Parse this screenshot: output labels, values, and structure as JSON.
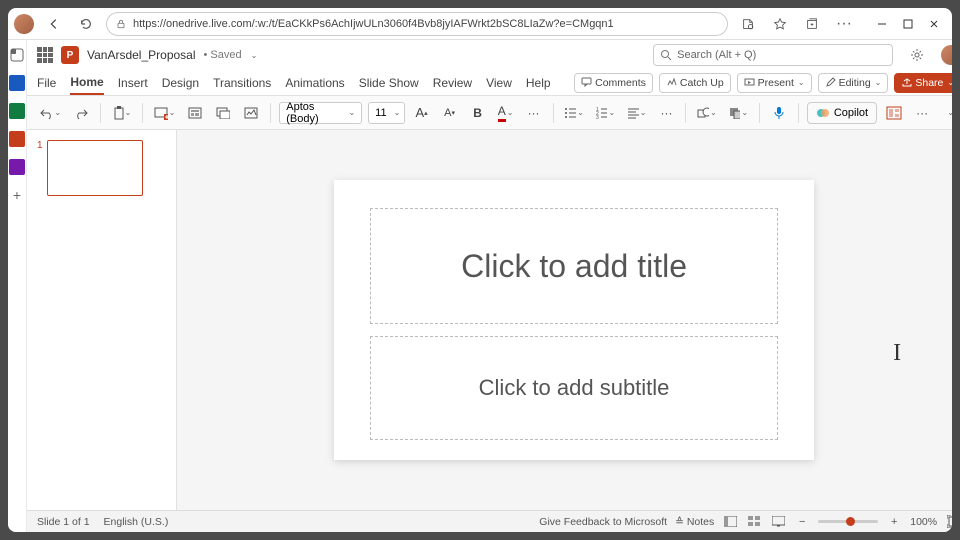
{
  "browser": {
    "url": "https://onedrive.live.com/:w:/t/EaCKkPs6AchIjwULn3060f4Bvb8jyIAFWrkt2bSC8LIaZw?e=CMgqn1"
  },
  "title": {
    "doc_name": "VanArsdel_Proposal",
    "saved": "• Saved ",
    "chev": "⌄",
    "search_placeholder": "Search (Alt + Q)"
  },
  "tabs": {
    "file": "File",
    "home": "Home",
    "insert": "Insert",
    "design": "Design",
    "transitions": "Transitions",
    "animations": "Animations",
    "slideshow": "Slide Show",
    "review": "Review",
    "view": "View",
    "help": "Help"
  },
  "tab_buttons": {
    "comments": "Comments",
    "catchup": "Catch Up",
    "present": "Present",
    "editing": "Editing",
    "share": "Share"
  },
  "ribbon": {
    "font": "Aptos (Body)",
    "size": "11",
    "bold": "B",
    "fontA": "A",
    "moreDots": "···",
    "copilot": "Copilot"
  },
  "slide": {
    "title": "Click to add title",
    "subtitle": "Click to add subtitle"
  },
  "status": {
    "slide": "Slide 1 of 1",
    "lang": "English (U.S.)",
    "feedback": "Give Feedback to Microsoft",
    "notes": "Notes",
    "zoom": "100%",
    "plus": "+",
    "minus": "−"
  },
  "thumb": {
    "num": "1"
  }
}
